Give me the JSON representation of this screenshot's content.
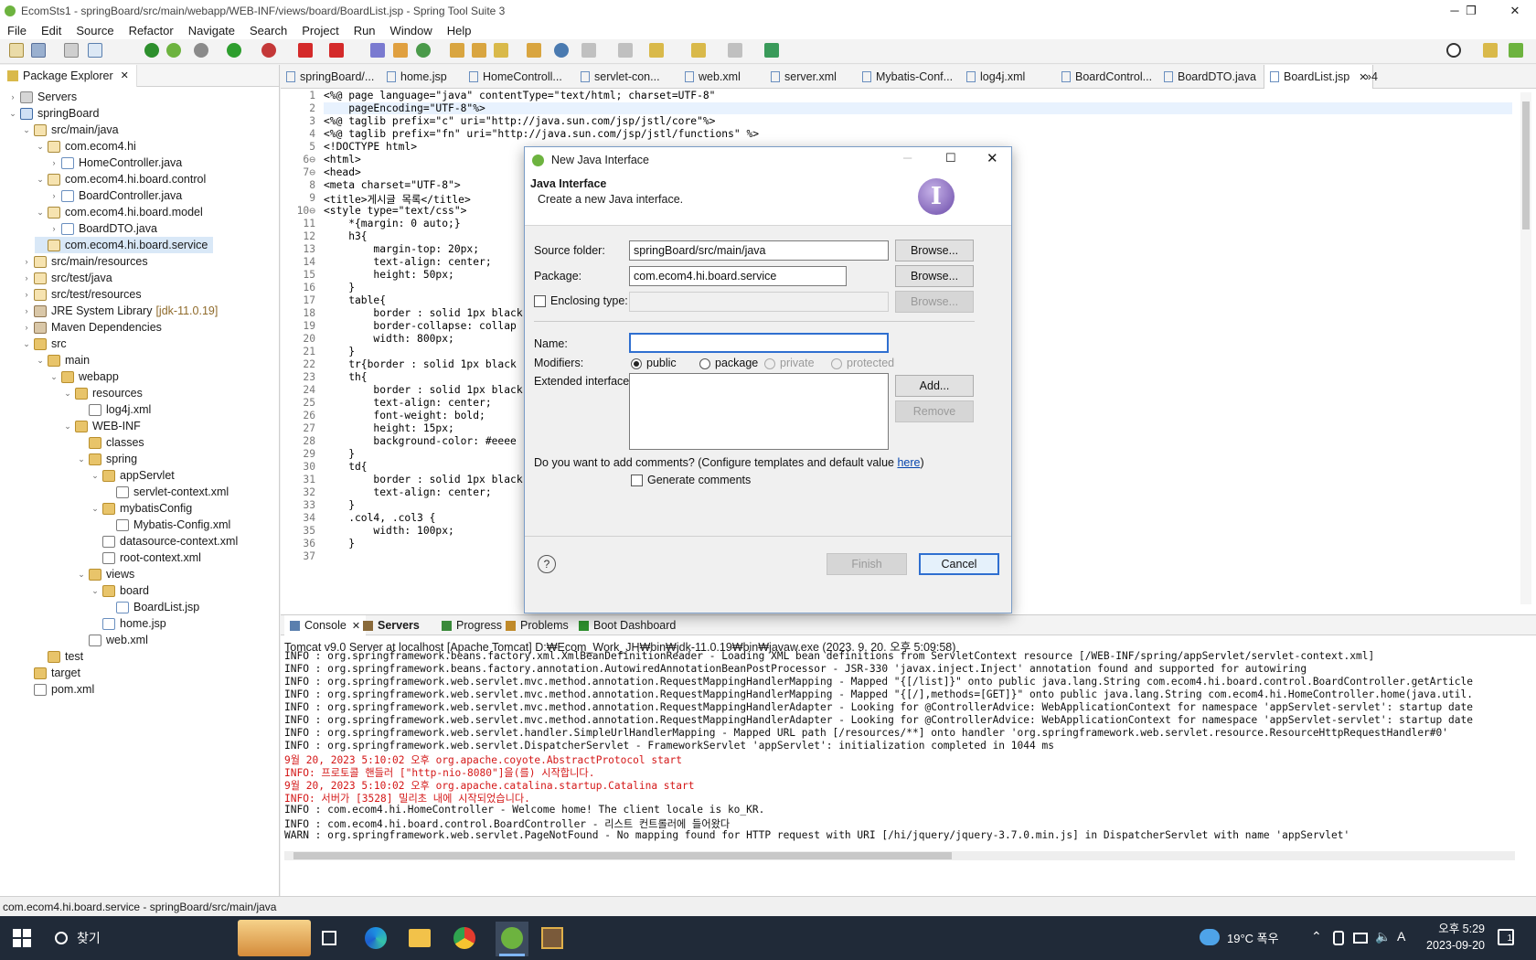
{
  "window": {
    "title": "EcomSts1 - springBoard/src/main/webapp/WEB-INF/views/board/BoardList.jsp - Spring Tool Suite 3",
    "minimize": "─",
    "restore": "❐",
    "close": "✕"
  },
  "menu": [
    "File",
    "Edit",
    "Source",
    "Refactor",
    "Navigate",
    "Search",
    "Project",
    "Run",
    "Window",
    "Help"
  ],
  "package_explorer": {
    "title": "Package Explorer",
    "items": [
      {
        "label": "Servers",
        "icon": "srv",
        "level": 0,
        "twisty": "›"
      },
      {
        "label": "springBoard",
        "icon": "proj",
        "level": 0,
        "twisty": "⌄"
      },
      {
        "label": "src/main/java",
        "icon": "pkg",
        "level": 1,
        "twisty": "⌄"
      },
      {
        "label": "com.ecom4.hi",
        "icon": "pkg",
        "level": 2,
        "twisty": "⌄"
      },
      {
        "label": "HomeController.java",
        "icon": "java",
        "level": 3,
        "twisty": "›"
      },
      {
        "label": "com.ecom4.hi.board.control",
        "icon": "pkg",
        "level": 2,
        "twisty": "⌄"
      },
      {
        "label": "BoardController.java",
        "icon": "java",
        "level": 3,
        "twisty": "›"
      },
      {
        "label": "com.ecom4.hi.board.model",
        "icon": "pkg",
        "level": 2,
        "twisty": "⌄"
      },
      {
        "label": "BoardDTO.java",
        "icon": "java",
        "level": 3,
        "twisty": "›"
      },
      {
        "label": "com.ecom4.hi.board.service",
        "icon": "pkg",
        "level": 2,
        "twisty": "",
        "selected": true
      },
      {
        "label": "src/main/resources",
        "icon": "pkg",
        "level": 1,
        "twisty": "›"
      },
      {
        "label": "src/test/java",
        "icon": "pkg",
        "level": 1,
        "twisty": "›"
      },
      {
        "label": "src/test/resources",
        "icon": "pkg",
        "level": 1,
        "twisty": "›"
      },
      {
        "label": "JRE System Library",
        "extra": "[jdk-11.0.19]",
        "icon": "lib",
        "level": 1,
        "twisty": "›"
      },
      {
        "label": "Maven Dependencies",
        "icon": "lib",
        "level": 1,
        "twisty": "›"
      },
      {
        "label": "src",
        "icon": "folder",
        "level": 1,
        "twisty": "⌄"
      },
      {
        "label": "main",
        "icon": "folder",
        "level": 2,
        "twisty": "⌄"
      },
      {
        "label": "webapp",
        "icon": "folder",
        "level": 3,
        "twisty": "⌄"
      },
      {
        "label": "resources",
        "icon": "folder",
        "level": 4,
        "twisty": "⌄"
      },
      {
        "label": "log4j.xml",
        "icon": "xml",
        "level": 5,
        "twisty": ""
      },
      {
        "label": "WEB-INF",
        "icon": "folder",
        "level": 4,
        "twisty": "⌄"
      },
      {
        "label": "classes",
        "icon": "folder",
        "level": 5,
        "twisty": ""
      },
      {
        "label": "spring",
        "icon": "folder",
        "level": 5,
        "twisty": "⌄"
      },
      {
        "label": "appServlet",
        "icon": "folder",
        "level": 6,
        "twisty": "⌄"
      },
      {
        "label": "servlet-context.xml",
        "icon": "xml",
        "level": 7,
        "twisty": ""
      },
      {
        "label": "mybatisConfig",
        "icon": "folder",
        "level": 6,
        "twisty": "⌄"
      },
      {
        "label": "Mybatis-Config.xml",
        "icon": "xml",
        "level": 7,
        "twisty": ""
      },
      {
        "label": "datasource-context.xml",
        "icon": "xml",
        "level": 6,
        "twisty": ""
      },
      {
        "label": "root-context.xml",
        "icon": "xml",
        "level": 6,
        "twisty": ""
      },
      {
        "label": "views",
        "icon": "folder",
        "level": 5,
        "twisty": "⌄"
      },
      {
        "label": "board",
        "icon": "folder",
        "level": 6,
        "twisty": "⌄"
      },
      {
        "label": "BoardList.jsp",
        "icon": "java",
        "level": 7,
        "twisty": ""
      },
      {
        "label": "home.jsp",
        "icon": "java",
        "level": 6,
        "twisty": ""
      },
      {
        "label": "web.xml",
        "icon": "xml",
        "level": 5,
        "twisty": ""
      },
      {
        "label": "test",
        "icon": "folder",
        "level": 2,
        "twisty": ""
      },
      {
        "label": "target",
        "icon": "folder",
        "level": 1,
        "twisty": ""
      },
      {
        "label": "pom.xml",
        "icon": "xml",
        "level": 1,
        "twisty": ""
      }
    ]
  },
  "editor_tabs": [
    "springBoard/...",
    "home.jsp",
    "HomeControll...",
    "servlet-con...",
    "web.xml",
    "server.xml",
    "Mybatis-Conf...",
    "log4j.xml",
    "BoardControl...",
    "BoardDTO.java",
    "BoardList.jsp"
  ],
  "editor_overflow": "»4",
  "code_lines": [
    {
      "n": "1",
      "t": "<%@ page language=\"java\" contentType=\"text/html; charset=UTF-8\""
    },
    {
      "n": "2",
      "t": "    pageEncoding=\"UTF-8\"%>"
    },
    {
      "n": "3",
      "t": "<%@ taglib prefix=\"c\" uri=\"http://java.sun.com/jsp/jstl/core\"%>"
    },
    {
      "n": "4",
      "t": "<%@ taglib prefix=\"fn\" uri=\"http://java.sun.com/jsp/jstl/functions\" %>"
    },
    {
      "n": "5",
      "t": "<!DOCTYPE html>"
    },
    {
      "n": "6⊖",
      "t": "<html>"
    },
    {
      "n": "7⊖",
      "t": "<head>"
    },
    {
      "n": "8",
      "t": "<meta charset=\"UTF-8\">"
    },
    {
      "n": "9",
      "t": "<title>게시글 목록</title>"
    },
    {
      "n": "10⊖",
      "t": "<style type=\"text/css\">"
    },
    {
      "n": "11",
      "t": "    *{margin: 0 auto;}"
    },
    {
      "n": "12",
      "t": "    h3{"
    },
    {
      "n": "13",
      "t": "        margin-top: 20px;"
    },
    {
      "n": "14",
      "t": "        text-align: center;"
    },
    {
      "n": "15",
      "t": "        height: 50px;"
    },
    {
      "n": "16",
      "t": "    }"
    },
    {
      "n": "17",
      "t": "    table{"
    },
    {
      "n": "18",
      "t": "        border : solid 1px black"
    },
    {
      "n": "19",
      "t": "        border-collapse: collap"
    },
    {
      "n": "20",
      "t": "        width: 800px;"
    },
    {
      "n": "21",
      "t": "    }"
    },
    {
      "n": "22",
      "t": "    tr{border : solid 1px black"
    },
    {
      "n": "23",
      "t": "    th{"
    },
    {
      "n": "24",
      "t": "        border : solid 1px black"
    },
    {
      "n": "25",
      "t": "        text-align: center;"
    },
    {
      "n": "26",
      "t": "        font-weight: bold;"
    },
    {
      "n": "27",
      "t": "        height: 15px;"
    },
    {
      "n": "28",
      "t": "        background-color: #eeee"
    },
    {
      "n": "29",
      "t": "    }"
    },
    {
      "n": "30",
      "t": "    td{"
    },
    {
      "n": "31",
      "t": "        border : solid 1px black"
    },
    {
      "n": "32",
      "t": "        text-align: center;"
    },
    {
      "n": "33",
      "t": "    }"
    },
    {
      "n": "34",
      "t": "    .col4, .col3 {"
    },
    {
      "n": "35",
      "t": "        width: 100px;"
    },
    {
      "n": "36",
      "t": "    }"
    },
    {
      "n": "37",
      "t": ""
    }
  ],
  "dialog": {
    "title": "New Java Interface",
    "header_title": "Java Interface",
    "header_desc": "Create a new Java interface.",
    "source_folder_label": "Source folder:",
    "source_folder_value": "springBoard/src/main/java",
    "package_label": "Package:",
    "package_value": "com.ecom4.hi.board.service",
    "enclosing_label": "Enclosing type:",
    "browse": "Browse...",
    "name_label": "Name:",
    "name_value": "",
    "modifiers_label": "Modifiers:",
    "modifiers": [
      "public",
      "package",
      "private",
      "protected"
    ],
    "extended_label": "Extended interfaces:",
    "add": "Add...",
    "remove": "Remove",
    "comments_question": "Do you want to add comments? (Configure templates and default value ",
    "comments_link": "here",
    "comments_close": ")",
    "generate_comments": "Generate comments",
    "finish": "Finish",
    "cancel": "Cancel",
    "help": "?",
    "logo": "I"
  },
  "console": {
    "tabs": [
      "Console",
      "Servers",
      "Progress",
      "Problems",
      "Boot Dashboard"
    ],
    "process": "Tomcat v9.0 Server at localhost [Apache Tomcat] D:₩Ecom_Work_JH₩bin₩jdk-11.0.19₩bin₩javaw.exe  (2023. 9. 20. 오후 5:09:58)",
    "lines": [
      {
        "t": "INFO : org.springframework.beans.factory.xml.XmlBeanDefinitionReader - Loading XML bean definitions from ServletContext resource [/WEB-INF/spring/appServlet/servlet-context.xml]",
        "red": false
      },
      {
        "t": "INFO : org.springframework.beans.factory.annotation.AutowiredAnnotationBeanPostProcessor - JSR-330 'javax.inject.Inject' annotation found and supported for autowiring",
        "red": false
      },
      {
        "t": "INFO : org.springframework.web.servlet.mvc.method.annotation.RequestMappingHandlerMapping - Mapped \"{[/list]}\" onto public java.lang.String com.ecom4.hi.board.control.BoardController.getArticle",
        "red": false
      },
      {
        "t": "INFO : org.springframework.web.servlet.mvc.method.annotation.RequestMappingHandlerMapping - Mapped \"{[/],methods=[GET]}\" onto public java.lang.String com.ecom4.hi.HomeController.home(java.util.",
        "red": false
      },
      {
        "t": "INFO : org.springframework.web.servlet.mvc.method.annotation.RequestMappingHandlerAdapter - Looking for @ControllerAdvice: WebApplicationContext for namespace 'appServlet-servlet': startup date",
        "red": false
      },
      {
        "t": "INFO : org.springframework.web.servlet.mvc.method.annotation.RequestMappingHandlerAdapter - Looking for @ControllerAdvice: WebApplicationContext for namespace 'appServlet-servlet': startup date",
        "red": false
      },
      {
        "t": "INFO : org.springframework.web.servlet.handler.SimpleUrlHandlerMapping - Mapped URL path [/resources/**] onto handler 'org.springframework.web.servlet.resource.ResourceHttpRequestHandler#0'",
        "red": false
      },
      {
        "t": "INFO : org.springframework.web.servlet.DispatcherServlet - FrameworkServlet 'appServlet': initialization completed in 1044 ms",
        "red": false
      },
      {
        "t": "9월 20, 2023 5:10:02 오후 org.apache.coyote.AbstractProtocol start",
        "red": true
      },
      {
        "t": "INFO: 프로토콜 핸들러 [\"http-nio-8080\"]을(를) 시작합니다.",
        "red": true
      },
      {
        "t": "9월 20, 2023 5:10:02 오후 org.apache.catalina.startup.Catalina start",
        "red": true
      },
      {
        "t": "INFO: 서버가 [3528] 밀리초 내에 시작되었습니다.",
        "red": true
      },
      {
        "t": "INFO : com.ecom4.hi.HomeController - Welcome home! The client locale is ko_KR.",
        "red": false
      },
      {
        "t": "INFO : com.ecom4.hi.board.control.BoardController - 리스트 컨트롤러에 들어왔다",
        "red": false
      },
      {
        "t": "WARN : org.springframework.web.servlet.PageNotFound - No mapping found for HTTP request with URI [/hi/jquery/jquery-3.7.0.min.js] in DispatcherServlet with name 'appServlet'",
        "red": false
      }
    ]
  },
  "status_text": "com.ecom4.hi.board.service - springBoard/src/main/java",
  "taskbar": {
    "search": "찾기",
    "weather": "19°C 폭우",
    "time": "오후 5:29",
    "date": "2023-09-20",
    "ime": "A",
    "notif": "1"
  }
}
